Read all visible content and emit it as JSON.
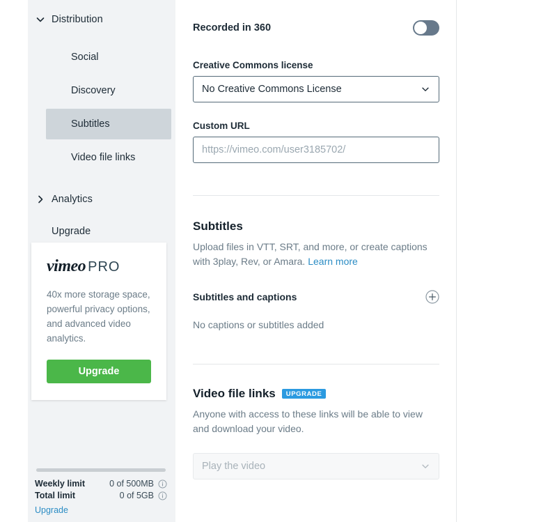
{
  "sidebar": {
    "groups": [
      {
        "label": "Distribution",
        "expanded": true,
        "icon": "chevron-down-icon",
        "items": [
          {
            "label": "Social",
            "active": false
          },
          {
            "label": "Discovery",
            "active": false
          },
          {
            "label": "Subtitles",
            "active": true
          },
          {
            "label": "Video file links",
            "active": false
          }
        ]
      },
      {
        "label": "Analytics",
        "expanded": false,
        "icon": "chevron-right-icon",
        "items": []
      }
    ],
    "upgrade_item": "Upgrade",
    "promo": {
      "logo_main": "vimeo",
      "logo_suffix": "PRO",
      "copy": "40x more storage space, powerful privacy options, and advanced video analytics.",
      "button": "Upgrade",
      "button_color": "#4bb749"
    },
    "footer": {
      "limits": [
        {
          "name": "Weekly limit",
          "value": "0 of 500MB",
          "info": "info-icon"
        },
        {
          "name": "Total limit",
          "value": "0 of 5GB",
          "info": "info-icon"
        }
      ],
      "link": "Upgrade",
      "link_color": "#2b8cc4"
    }
  },
  "main": {
    "recorded_360": {
      "label": "Recorded in 360",
      "toggle_state": "off",
      "toggle_color": "#67798b"
    },
    "cc_license": {
      "label": "Creative Commons license",
      "value": "No Creative Commons License",
      "caret": "chevron-down-icon"
    },
    "custom_url": {
      "label": "Custom URL",
      "value": "",
      "placeholder": "https://vimeo.com/user3185702/"
    },
    "subtitles": {
      "title": "Subtitles",
      "desc_before": "Upload files in VTT, SRT, and more, or create captions with 3play, Rev, or Amara. ",
      "desc_link": "Learn more",
      "sub_head": "Subtitles and captions",
      "add_icon": "plus-circle-icon",
      "empty": "No captions or subtitles added"
    },
    "video_file_links": {
      "title": "Video file links",
      "badge": "UPGRADE",
      "badge_color": "#2b9ae0",
      "desc": "Anyone with access to these links will be able to view and download your video.",
      "select_value": "Play the video",
      "select_disabled": true,
      "caret": "chevron-down-icon"
    }
  }
}
